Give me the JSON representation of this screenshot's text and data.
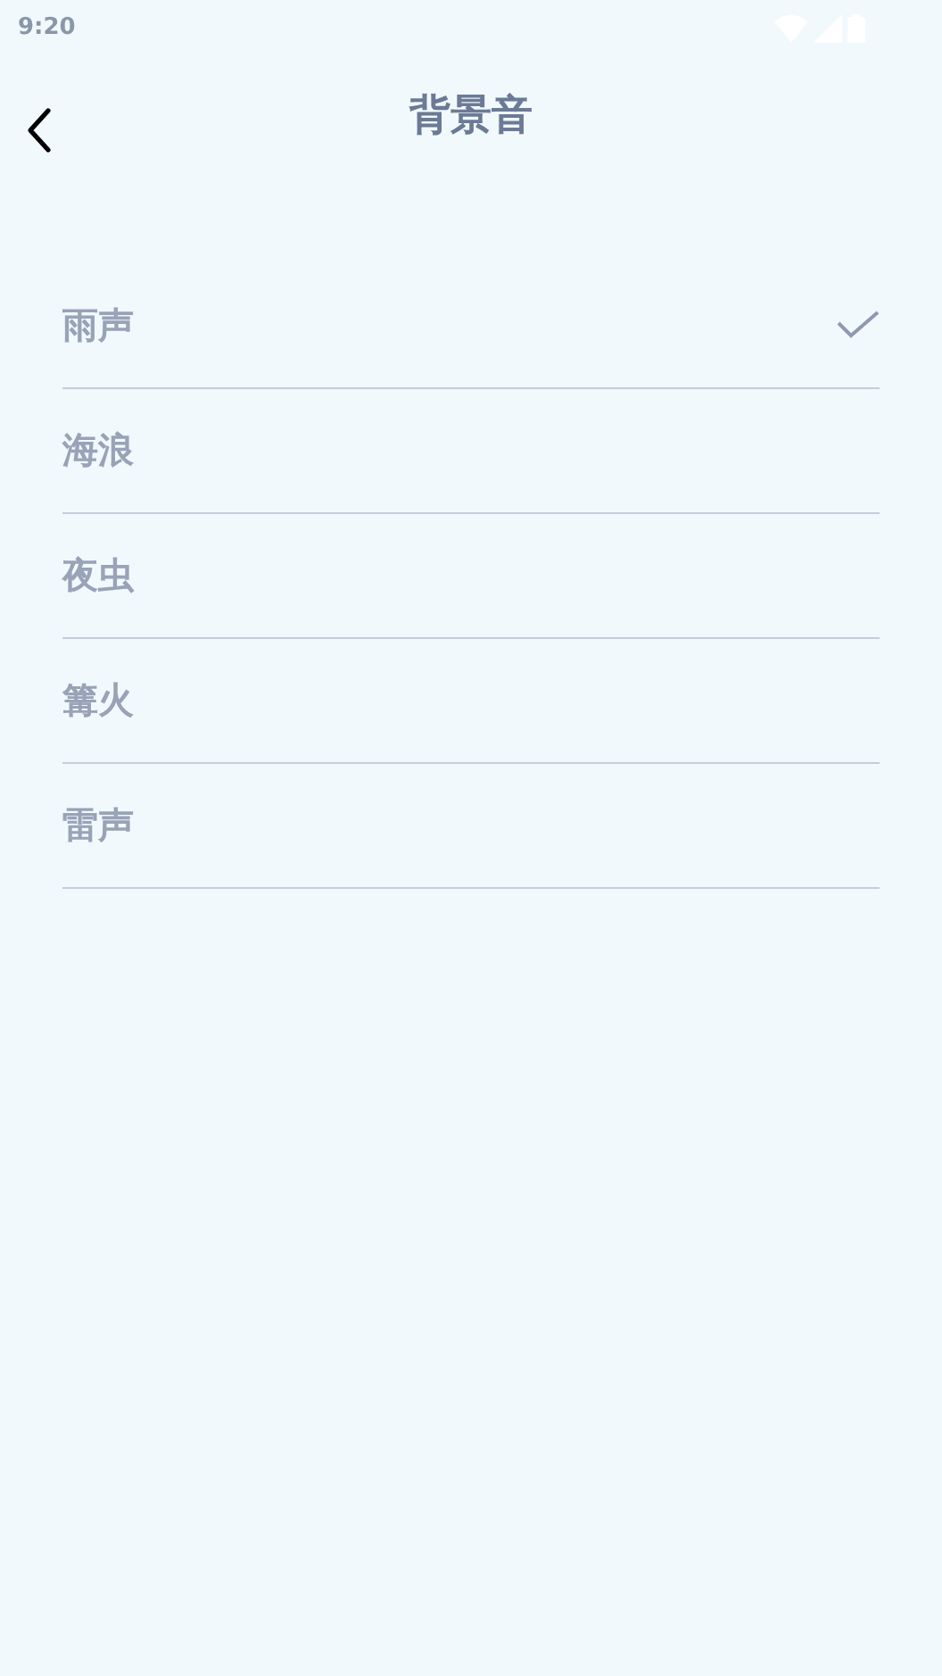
{
  "status_bar": {
    "time": "9:20"
  },
  "header": {
    "title": "背景音"
  },
  "options": [
    {
      "label": "雨声",
      "selected": true
    },
    {
      "label": "海浪",
      "selected": false
    },
    {
      "label": "夜虫",
      "selected": false
    },
    {
      "label": "篝火",
      "selected": false
    },
    {
      "label": "雷声",
      "selected": false
    }
  ]
}
